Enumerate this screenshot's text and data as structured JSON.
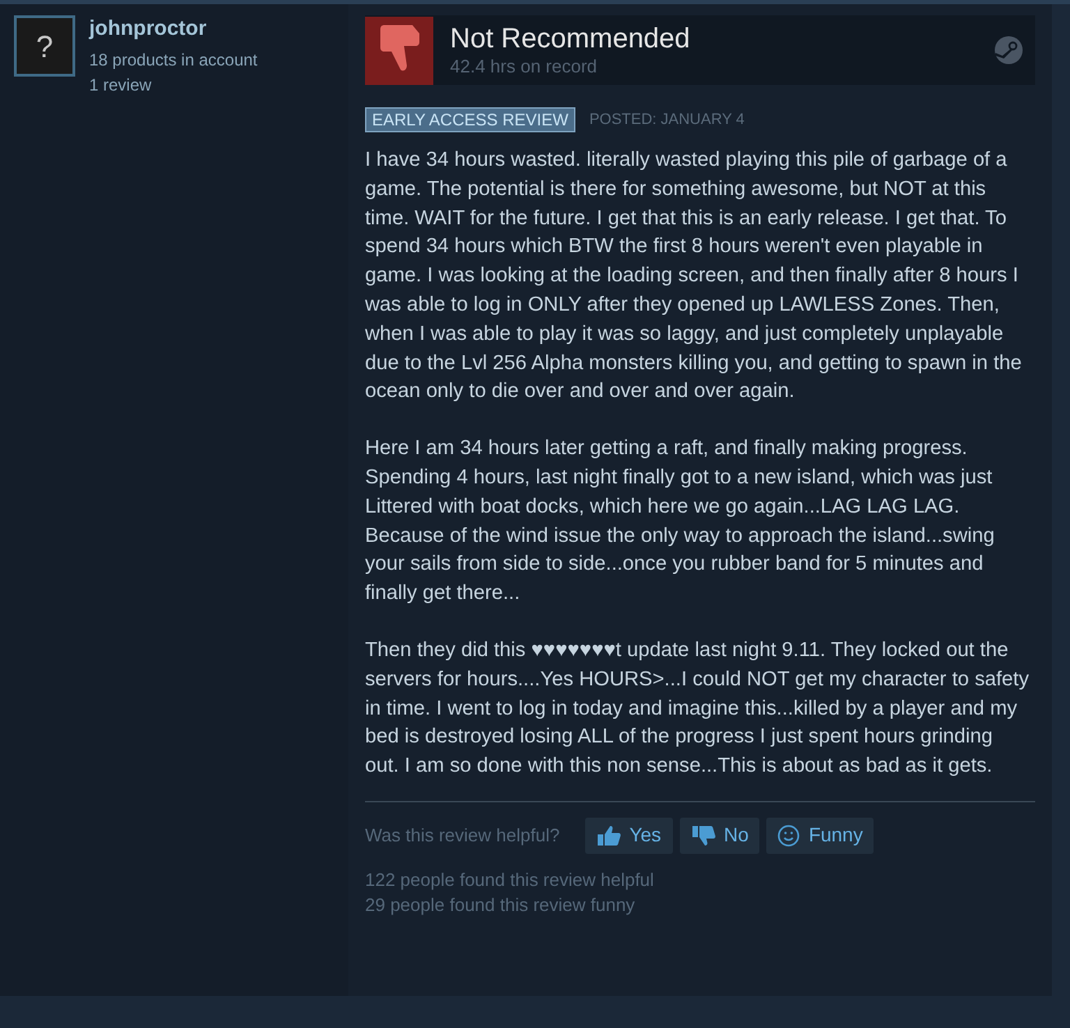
{
  "author": {
    "avatar_glyph": "?",
    "name": "johnproctor",
    "products": "18 products in account",
    "reviews": "1 review"
  },
  "header": {
    "verdict": "Not Recommended",
    "recommended": false,
    "hours": "42.4 hrs on record"
  },
  "badge": "EARLY ACCESS REVIEW",
  "posted": "POSTED: JANUARY 4",
  "paragraphs": [
    "I have 34 hours wasted. literally wasted playing this pile of garbage of a game. The potential is there for something awesome, but NOT at this time. WAIT for the future. I get that this is an early release. I get that. To spend 34 hours which BTW the first 8 hours weren't even playable in game. I was looking at the loading screen, and then finally after 8 hours I was able to log in ONLY after they opened up LAWLESS Zones. Then, when I was able to play it was so laggy, and just completely unplayable due to the Lvl 256 Alpha monsters killing you, and getting to spawn in the ocean only to die over and over and over again.",
    "Here I am 34 hours later getting a raft, and finally making progress. Spending 4 hours, last night finally got to a new island, which was just Littered with boat docks, which here we go again...LAG LAG LAG. Because of the wind issue the only way to approach the island...swing your sails from side to side...once you rubber band for 5 minutes and finally get there...",
    "Then they did this ♥♥♥♥♥♥♥t update last night 9.11. They locked out the servers for hours....Yes HOURS>...I could NOT get my character to safety in time. I went to log in today and imagine this...killed by a player and my bed is destroyed losing ALL of the progress I just spent hours grinding out. I am so done with this non sense...This is about as bad as it gets."
  ],
  "helpful_prompt": "Was this review helpful?",
  "votes": [
    {
      "kind": "yes",
      "label": "Yes"
    },
    {
      "kind": "no",
      "label": "No"
    },
    {
      "kind": "funny",
      "label": "Funny"
    }
  ],
  "stats": [
    "122 people found this review helpful",
    "29 people found this review funny"
  ]
}
